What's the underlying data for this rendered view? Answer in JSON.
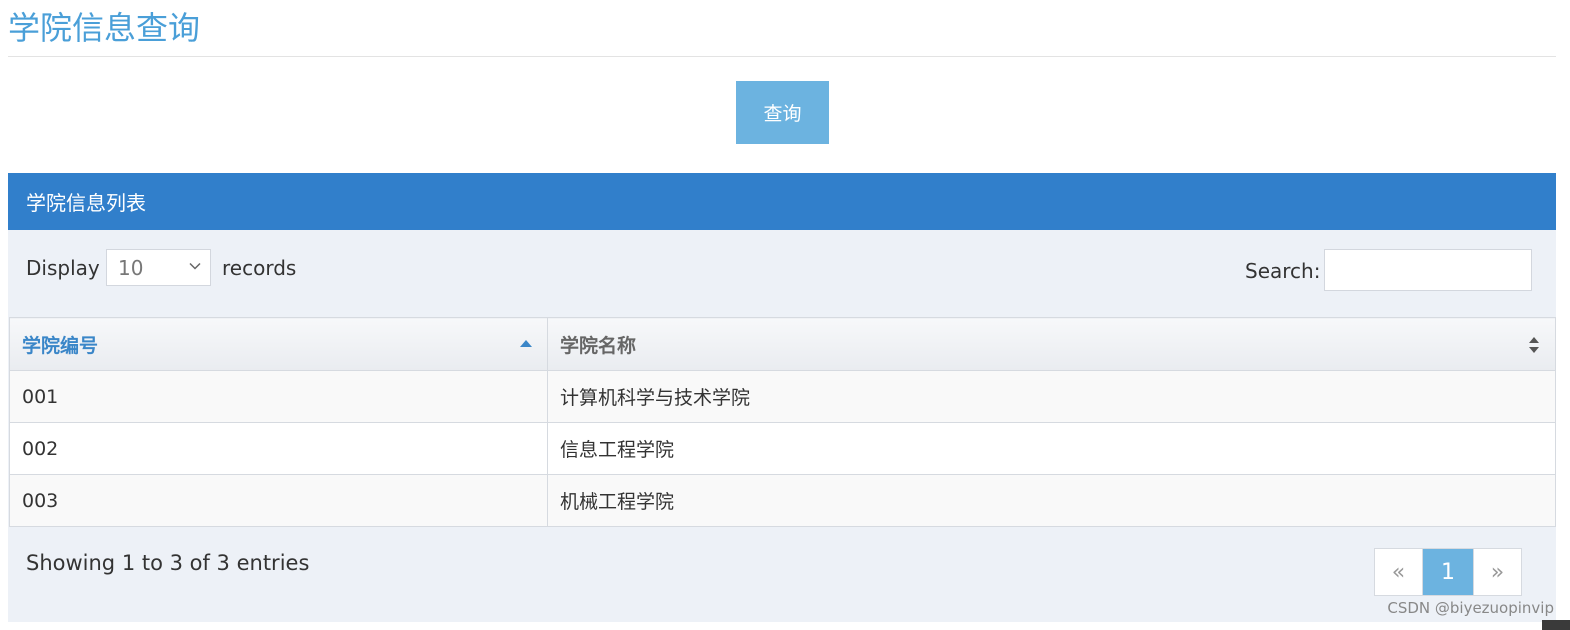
{
  "page": {
    "title": "学院信息查询",
    "query_button": "查询"
  },
  "panel": {
    "heading": "学院信息列表",
    "length_control": {
      "prefix": "Display",
      "selected": "10",
      "suffix": "records"
    },
    "search": {
      "label": "Search:",
      "value": ""
    },
    "table": {
      "columns": [
        {
          "label": "学院编号",
          "sort": "ascending"
        },
        {
          "label": "学院名称",
          "sort": "none"
        }
      ],
      "rows": [
        {
          "id": "001",
          "name": "计算机科学与技术学院"
        },
        {
          "id": "002",
          "name": "信息工程学院"
        },
        {
          "id": "003",
          "name": "机械工程学院"
        }
      ]
    },
    "info": "Showing 1 to 3 of 3 entries",
    "pagination": {
      "prev": "«",
      "current": "1",
      "next": "»"
    }
  },
  "watermark": "CSDN @biyezuopinvip",
  "colors": {
    "title": "#4a9fd8",
    "accent": "#317fcb",
    "button": "#6cb3e0",
    "panel_bg": "#edf1f7"
  }
}
